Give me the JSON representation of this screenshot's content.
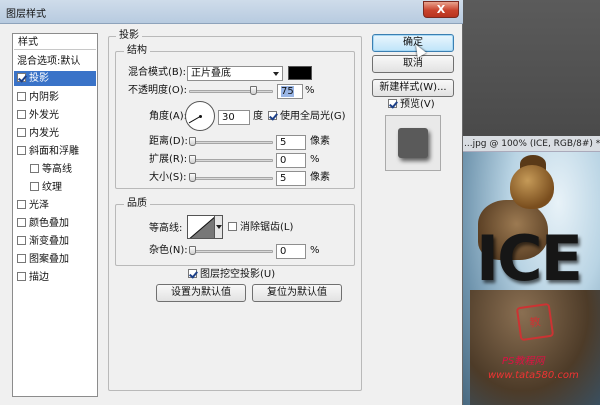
{
  "dialog": {
    "title": "图层样式",
    "close_label": "X"
  },
  "style_list": {
    "header": "样式",
    "blend_options": "混合选项:默认",
    "items": [
      {
        "label": "投影",
        "checked": true,
        "selected": true
      },
      {
        "label": "内阴影",
        "checked": false
      },
      {
        "label": "外发光",
        "checked": false
      },
      {
        "label": "内发光",
        "checked": false
      },
      {
        "label": "斜面和浮雕",
        "checked": false
      },
      {
        "label": "等高线",
        "checked": false
      },
      {
        "label": "纹理",
        "checked": false
      },
      {
        "label": "光泽",
        "checked": false
      },
      {
        "label": "颜色叠加",
        "checked": false
      },
      {
        "label": "渐变叠加",
        "checked": false
      },
      {
        "label": "图案叠加",
        "checked": false
      },
      {
        "label": "描边",
        "checked": false
      }
    ]
  },
  "drop_shadow": {
    "section_title": "投影",
    "structure_title": "结构",
    "blend_mode_label": "混合模式(B):",
    "blend_mode_value": "正片叠底",
    "shadow_color": "#000000",
    "opacity_label": "不透明度(O):",
    "opacity_value": "75",
    "opacity_unit": "%",
    "angle_label": "角度(A):",
    "angle_value": "30",
    "angle_unit": "度",
    "global_light_label": "使用全局光(G)",
    "global_light_checked": true,
    "distance_label": "距离(D):",
    "distance_value": "5",
    "distance_unit": "像素",
    "spread_label": "扩展(R):",
    "spread_value": "0",
    "spread_unit": "%",
    "size_label": "大小(S):",
    "size_value": "5",
    "size_unit": "像素"
  },
  "quality": {
    "title": "品质",
    "contour_label": "等高线:",
    "anti_alias_label": "消除锯齿(L)",
    "anti_alias_checked": false,
    "noise_label": "杂色(N):",
    "noise_value": "0",
    "noise_unit": "%"
  },
  "knockout": {
    "label": "图层挖空投影(U)",
    "checked": true
  },
  "defaults": {
    "make_default": "设置为默认值",
    "reset_default": "复位为默认值"
  },
  "buttons": {
    "ok": "确定",
    "cancel": "取消",
    "new_style": "新建样式(W)...",
    "preview_label": "预览(V)",
    "preview_checked": true
  },
  "background_document": {
    "title": "...jpg @ 100% (ICE, RGB/8#) *",
    "image_text": "ICE",
    "watermark_line1": "PS教程网",
    "watermark_line2": "www.tata580.com",
    "stamp_text": "教"
  }
}
